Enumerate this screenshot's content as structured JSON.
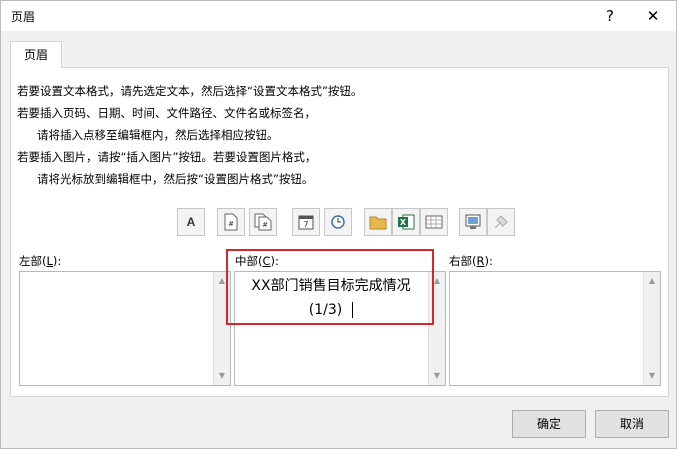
{
  "window": {
    "title": "页眉",
    "help_glyph": "?",
    "close_glyph": "✕"
  },
  "tab": {
    "label": "页眉"
  },
  "instructions": {
    "line1": "若要设置文本格式，请先选定文本，然后选择“设置文本格式”按钮。",
    "line2": "若要插入页码、日期、时间、文件路径、文件名或标签名，",
    "line3": "请将插入点移至编辑框内，然后选择相应按钮。",
    "line4": "若要插入图片，请按“插入图片”按钮。若要设置图片格式，",
    "line5": "请将光标放到编辑框中，然后按“设置图片格式”按钮。"
  },
  "toolbar": {
    "buttons": [
      {
        "icon": "format-text-icon",
        "glyph": "A"
      },
      {
        "icon": "insert-page-number-icon",
        "glyph": "#"
      },
      {
        "icon": "insert-page-count-icon",
        "glyph": "#"
      },
      {
        "icon": "insert-date-icon",
        "glyph": "7"
      },
      {
        "icon": "insert-time-icon",
        "glyph": ""
      },
      {
        "icon": "insert-file-path-icon",
        "glyph": ""
      },
      {
        "icon": "insert-file-name-icon",
        "glyph": "X"
      },
      {
        "icon": "insert-sheet-name-icon",
        "glyph": ""
      },
      {
        "icon": "insert-picture-icon",
        "glyph": ""
      },
      {
        "icon": "format-picture-icon",
        "glyph": ""
      }
    ]
  },
  "sections": {
    "left": {
      "label_prefix": "左部(",
      "label_key": "L",
      "label_suffix": "):",
      "content": ""
    },
    "center": {
      "label_prefix": "中部(",
      "label_key": "C",
      "label_suffix": "):",
      "content_line1": "XX部门销售目标完成情况",
      "content_line2": "(1/3)"
    },
    "right": {
      "label_prefix": "右部(",
      "label_key": "R",
      "label_suffix": "):",
      "content": ""
    }
  },
  "scroll": {
    "up": "▲",
    "down": "▼"
  },
  "buttons": {
    "ok": "确定",
    "cancel": "取消"
  },
  "colors": {
    "highlight_border": "#d9262b"
  }
}
